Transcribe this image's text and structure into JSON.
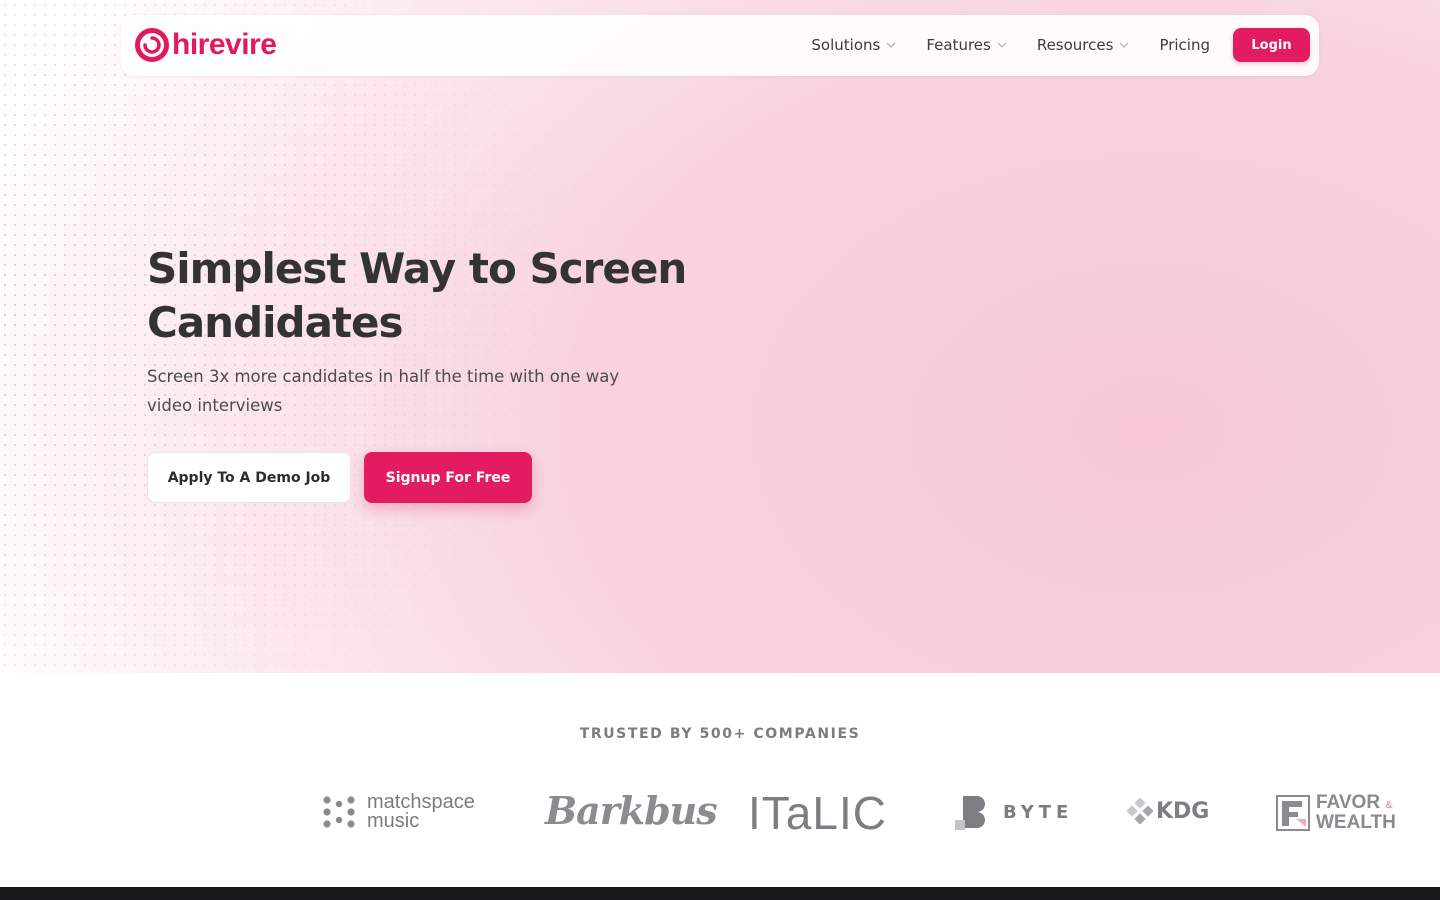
{
  "brand": {
    "name": "hirevire",
    "accent_color": "#e31c62"
  },
  "nav": {
    "items": [
      {
        "label": "Solutions",
        "has_dropdown": true
      },
      {
        "label": "Features",
        "has_dropdown": true
      },
      {
        "label": "Resources",
        "has_dropdown": true
      },
      {
        "label": "Pricing",
        "has_dropdown": false
      }
    ],
    "login_label": "Login"
  },
  "hero": {
    "headline_line1": "Simplest Way to Screen",
    "headline_line2": "Candidates",
    "subheadline": "Screen 3x more candidates in half the time with one way video interviews",
    "primary_cta": "Signup For Free",
    "secondary_cta": "Apply To A Demo Job"
  },
  "trusted": {
    "label": "TRUSTED BY 500+ COMPANIES",
    "logos": [
      {
        "name": "matchspace music",
        "line1": "matchspace",
        "line2": "music"
      },
      {
        "name": "Barkbus",
        "text": "Barkbus"
      },
      {
        "name": "ITALIC",
        "text": "ITaLIC"
      },
      {
        "name": "BYTE",
        "text": "BYTE"
      },
      {
        "name": "KDG",
        "text": "KDG"
      },
      {
        "name": "FAVOR & WEALTH",
        "line1": "FAVOR",
        "amp": "&",
        "line2": "WEALTH"
      }
    ]
  }
}
